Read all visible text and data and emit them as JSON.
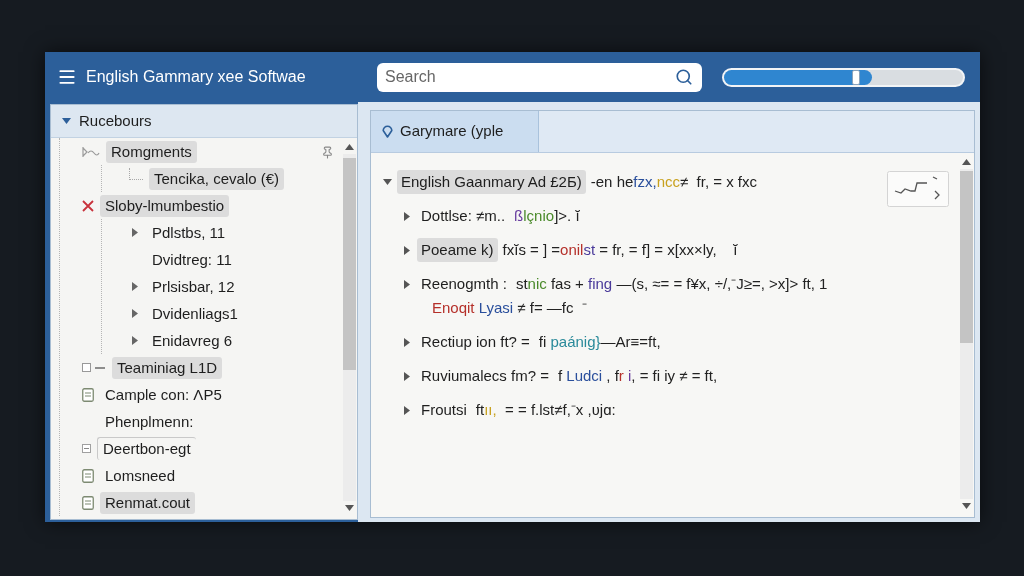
{
  "window": {
    "title": "English Gammary xee Softwae"
  },
  "search": {
    "placeholder": "Search"
  },
  "slider": {
    "level": 0.62
  },
  "sidebar": {
    "header": {
      "label": "Rucebours",
      "expanded": true
    },
    "items": [
      {
        "label": "Romgments",
        "kind": "link",
        "highlighted": true,
        "children": [
          {
            "label": "Tencika, cevalo (€)",
            "kind": "elbow",
            "highlighted": true
          }
        ]
      },
      {
        "label": "Sloby-lmumbestio",
        "kind": "error",
        "highlighted": true,
        "children": [
          {
            "label": "Pdlstbs, 11",
            "kind": "branch",
            "expanded": false,
            "highlighted": false
          },
          {
            "label": "Dvidtreg: 11",
            "kind": "plain",
            "highlighted": false
          },
          {
            "label": "Prlsisbar, 12",
            "kind": "branch",
            "expanded": false,
            "highlighted": false
          },
          {
            "label": "Dvidenliags1",
            "kind": "branch",
            "expanded": false,
            "highlighted": false
          },
          {
            "label": "Enidavreg 6",
            "kind": "branch",
            "expanded": false,
            "highlighted": false
          }
        ]
      },
      {
        "label": "Teaminiag L1D",
        "kind": "group",
        "highlighted": true
      },
      {
        "label": "Cample con: ΛP5",
        "kind": "document",
        "highlighted": false
      },
      {
        "label": "Phenplmenn:",
        "kind": "plain",
        "highlighted": false
      },
      {
        "label": "Deertbon-egt",
        "kind": "boxed",
        "highlighted": false
      },
      {
        "label": "Lomsneed",
        "kind": "document",
        "highlighted": false
      },
      {
        "label": "Renmat.cout",
        "kind": "document",
        "highlighted": true
      }
    ]
  },
  "editor": {
    "tab": {
      "label": "Garymare (yple",
      "selected": true
    },
    "tree": [
      {
        "label": "English Gaanmary Ad £2Б)",
        "highlighted": true,
        "expanded": true,
        "lines": [
          [
            {
              "text": "-en he",
              "color": "#222222"
            },
            {
              "text": "fzx,",
              "color": "#2a4f9c"
            },
            {
              "text": "ncc",
              "color": "#c8a11e"
            },
            {
              "text": "≠  fr, = x fxc",
              "color": "#222222"
            }
          ]
        ],
        "children": [
          {
            "label": "Dottlse: ≠m..",
            "highlighted": false,
            "expanded": false,
            "lines": [
              [
                {
                  "text": "ß",
                  "color": "#6a3fa0"
                },
                {
                  "text": "lçnio",
                  "color": "#4a8a2a"
                },
                {
                  "text": "]>. ĭ",
                  "color": "#222222"
                }
              ]
            ]
          },
          {
            "label": "Poeame k)",
            "highlighted": true,
            "expanded": false,
            "lines": [
              [
                {
                  "text": "fxĭs = ] =",
                  "color": "#222222"
                },
                {
                  "text": "onil",
                  "color": "#b5302a"
                },
                {
                  "text": "st",
                  "color": "#4a3a9a"
                },
                {
                  "text": " = fr, = f] = x[xx×ly,    ĭ",
                  "color": "#222222"
                }
              ]
            ]
          },
          {
            "label": "Reenogmth :",
            "highlighted": false,
            "expanded": false,
            "lines": [
              [
                {
                  "text": "st",
                  "color": "#222222"
                },
                {
                  "text": "nic",
                  "color": "#4a8a2a"
                },
                {
                  "text": " fas + ",
                  "color": "#222222"
                },
                {
                  "text": "fing",
                  "color": "#4a3a9a"
                },
                {
                  "text": " —(s, ≈= = f¥x, ÷/,⁻J≥=, >x]> ft, 1",
                  "color": "#222222"
                }
              ],
              [
                {
                  "text": "Enoqit",
                  "color": "#b5302a"
                },
                {
                  "text": " Lyasi",
                  "color": "#2a4f9c"
                },
                {
                  "text": " ≠ f= —fc  ⁻",
                  "color": "#222222"
                }
              ]
            ]
          },
          {
            "label": "Rectiup ion ft? =",
            "highlighted": false,
            "expanded": false,
            "lines": [
              [
                {
                  "text": "fi ",
                  "color": "#222222"
                },
                {
                  "text": "paánig}",
                  "color": "#2a8a9a"
                },
                {
                  "text": "—Ar≡=ft,",
                  "color": "#222222"
                }
              ]
            ]
          },
          {
            "label": "Ruviumalecs fm? =",
            "highlighted": false,
            "expanded": false,
            "lines": [
              [
                {
                  "text": "f ",
                  "color": "#222222"
                },
                {
                  "text": "Ludci",
                  "color": "#2a4f9c"
                },
                {
                  "text": " , f",
                  "color": "#222222"
                },
                {
                  "text": "r",
                  "color": "#b5302a"
                },
                {
                  "text": " i",
                  "color": "#6a3fa0"
                },
                {
                  "text": ", = fi iy ≠ = ft,",
                  "color": "#222222"
                }
              ]
            ]
          },
          {
            "label": "Froutsi",
            "highlighted": false,
            "expanded": false,
            "lines": [
              [
                {
                  "text": "ft",
                  "color": "#222222"
                },
                {
                  "text": "ıı,",
                  "color": "#c8a11e"
                },
                {
                  "text": "  = = f.lst≠f,⁻x ,ʋjɑ:",
                  "color": "#222222"
                }
              ]
            ]
          }
        ]
      }
    ]
  }
}
